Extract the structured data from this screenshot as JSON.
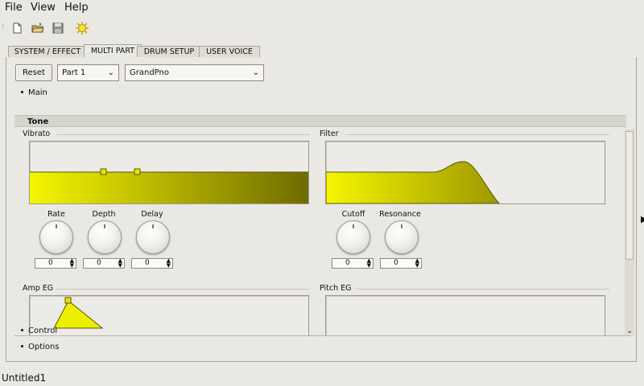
{
  "menubar": {
    "items": [
      "File",
      "View",
      "Help"
    ]
  },
  "toolbar": {
    "icons": [
      "new-file-icon",
      "open-folder-icon",
      "save-icon",
      "settings-sun-icon"
    ]
  },
  "tabs": [
    {
      "label": "SYSTEM / EFFECT",
      "active": false
    },
    {
      "label": "MULTI PART",
      "active": true
    },
    {
      "label": "DRUM SETUP",
      "active": false
    },
    {
      "label": "USER VOICE",
      "active": false
    }
  ],
  "controls": {
    "reset_label": "Reset",
    "part_select": "Part 1",
    "voice_select": "GrandPno"
  },
  "sections": {
    "main": "Main",
    "tone": "Tone",
    "control": "Control",
    "options": "Options"
  },
  "vibrato": {
    "title": "Vibrato",
    "knobs": [
      {
        "label": "Rate",
        "value": "0"
      },
      {
        "label": "Depth",
        "value": "0"
      },
      {
        "label": "Delay",
        "value": "0"
      }
    ]
  },
  "filter": {
    "title": "Filter",
    "knobs": [
      {
        "label": "Cutoff",
        "value": "0"
      },
      {
        "label": "Resonance",
        "value": "0"
      }
    ]
  },
  "amp_eg": {
    "title": "Amp EG"
  },
  "pitch_eg": {
    "title": "Pitch EG"
  },
  "colors": {
    "graph_fill_start": "#f4f400",
    "graph_fill_end": "#6e6b00",
    "handle": "#e8e400"
  },
  "statusbar": {
    "text": "Untitled1"
  }
}
